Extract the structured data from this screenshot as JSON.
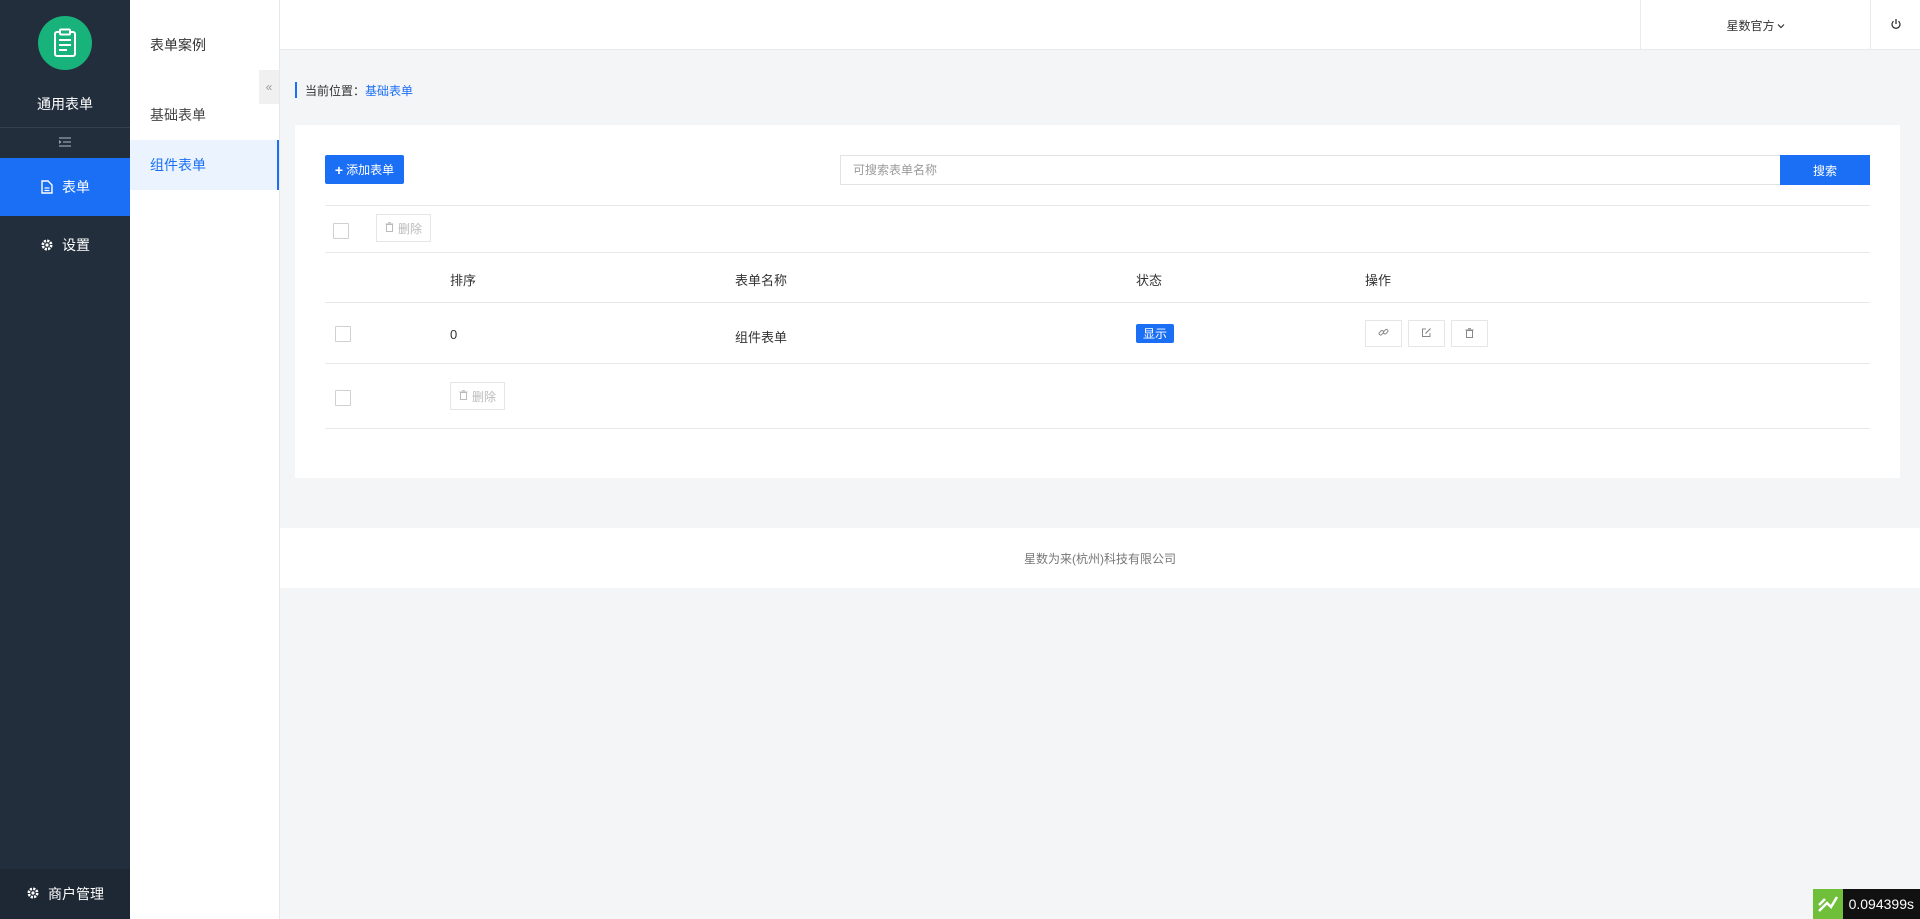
{
  "sidebar": {
    "app_title": "通用表单",
    "items": [
      {
        "label": "表单",
        "icon": "file-icon",
        "active": true
      },
      {
        "label": "设置",
        "icon": "gear-icon",
        "active": false
      }
    ],
    "bottom_label": "商户管理"
  },
  "subnav": {
    "title": "表单案例",
    "items": [
      {
        "label": "基础表单",
        "active": false
      },
      {
        "label": "组件表单",
        "active": true
      }
    ]
  },
  "topbar": {
    "user_name": "星数官方"
  },
  "breadcrumb": {
    "prefix": "当前位置：",
    "current": "基础表单"
  },
  "toolbar": {
    "add_label": "添加表单",
    "search_placeholder": "可搜索表单名称",
    "search_value": "",
    "search_label": "搜索",
    "delete_label": "删除"
  },
  "table": {
    "columns": [
      "排序",
      "表单名称",
      "状态",
      "操作"
    ],
    "rows": [
      {
        "sort": "0",
        "name": "组件表单",
        "status": "显示",
        "actions": [
          "link-icon",
          "edit-icon",
          "trash-icon"
        ]
      }
    ]
  },
  "footer": {
    "text": "星数为来(杭州)科技有限公司"
  },
  "timer": {
    "value": "0.094399s"
  },
  "colors": {
    "sidebar_bg": "#222e3c",
    "accent": "#1b6ff5",
    "logo_green": "#18b27b"
  }
}
